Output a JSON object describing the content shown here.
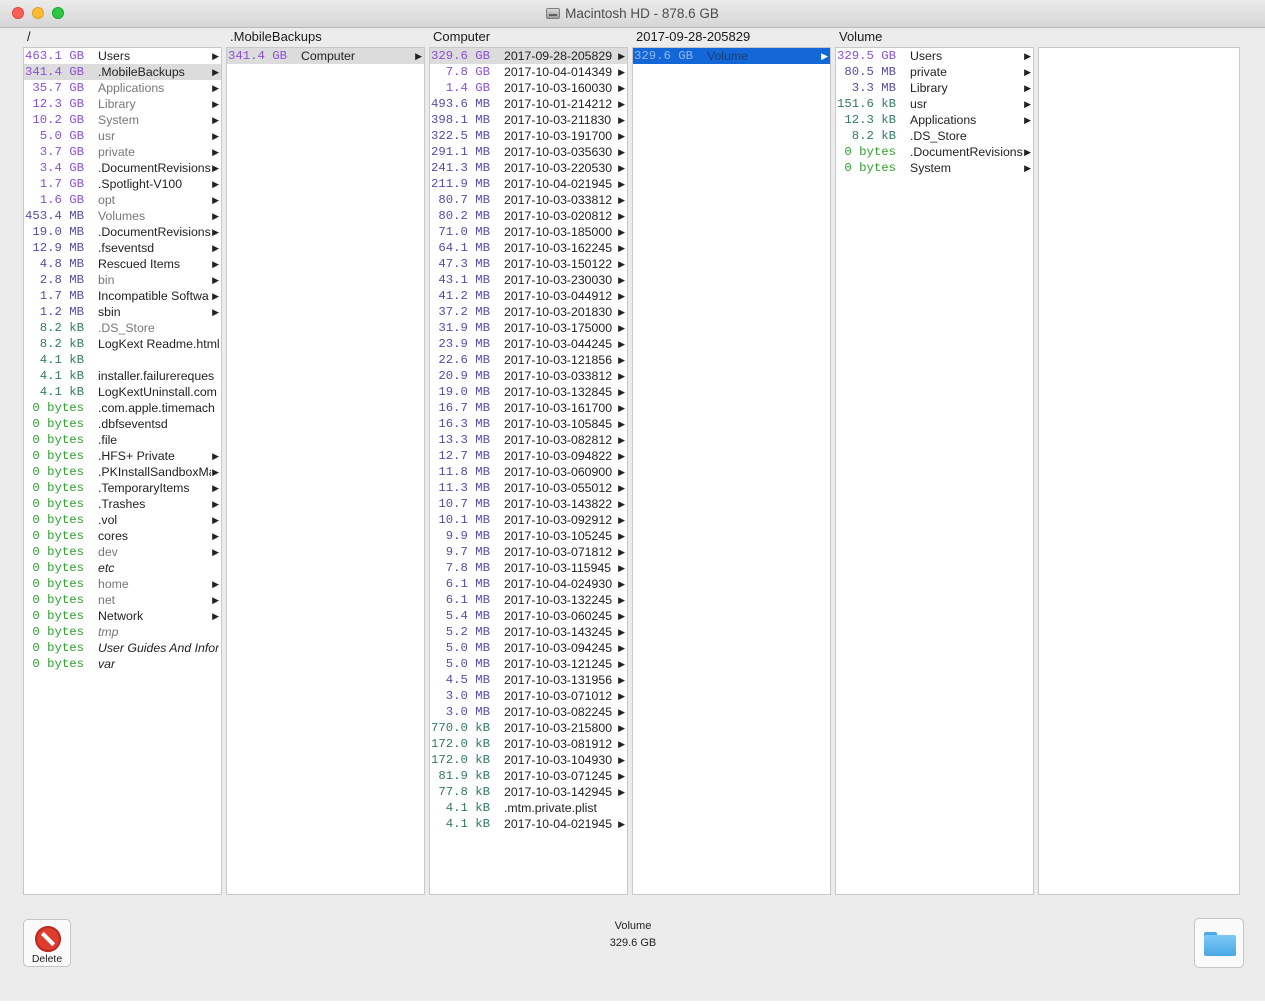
{
  "window": {
    "title": "Macintosh HD - 878.6 GB"
  },
  "columns": [
    {
      "header": "/",
      "rows": [
        {
          "size": "463.1 GB",
          "unit": "gb",
          "name": "Users",
          "arrow": true
        },
        {
          "size": "341.4 GB",
          "unit": "gb",
          "name": ".MobileBackups",
          "arrow": true,
          "selected": "gray"
        },
        {
          "size": "35.7 GB",
          "unit": "gb",
          "name": "Applications",
          "arrow": true,
          "style": "gray"
        },
        {
          "size": "12.3 GB",
          "unit": "gb",
          "name": "Library",
          "arrow": true,
          "style": "gray"
        },
        {
          "size": "10.2 GB",
          "unit": "gb",
          "name": "System",
          "arrow": true,
          "style": "gray"
        },
        {
          "size": "5.0 GB",
          "unit": "gb",
          "name": "usr",
          "arrow": true,
          "style": "gray"
        },
        {
          "size": "3.7 GB",
          "unit": "gb",
          "name": "private",
          "arrow": true,
          "style": "gray"
        },
        {
          "size": "3.4 GB",
          "unit": "gb",
          "name": ".DocumentRevisions",
          "arrow": true
        },
        {
          "size": "1.7 GB",
          "unit": "gb",
          "name": ".Spotlight-V100",
          "arrow": true
        },
        {
          "size": "1.6 GB",
          "unit": "gb",
          "name": "opt",
          "arrow": true,
          "style": "gray"
        },
        {
          "size": "453.4 MB",
          "unit": "mb",
          "name": "Volumes",
          "arrow": true,
          "style": "gray"
        },
        {
          "size": "19.0 MB",
          "unit": "mb",
          "name": ".DocumentRevisions",
          "arrow": true
        },
        {
          "size": "12.9 MB",
          "unit": "mb",
          "name": ".fseventsd",
          "arrow": true
        },
        {
          "size": "4.8 MB",
          "unit": "mb",
          "name": "Rescued Items",
          "arrow": true
        },
        {
          "size": "2.8 MB",
          "unit": "mb",
          "name": "bin",
          "arrow": true,
          "style": "gray"
        },
        {
          "size": "1.7 MB",
          "unit": "mb",
          "name": "Incompatible Softwa",
          "arrow": true
        },
        {
          "size": "1.2 MB",
          "unit": "mb",
          "name": "sbin",
          "arrow": true
        },
        {
          "size": "8.2 kB",
          "unit": "kb",
          "name": ".DS_Store",
          "arrow": false,
          "style": "gray"
        },
        {
          "size": "8.2 kB",
          "unit": "kb",
          "name": "LogKext Readme.html",
          "arrow": false
        },
        {
          "size": "4.1 kB",
          "unit": "kb",
          "name": "",
          "arrow": false
        },
        {
          "size": "4.1 kB",
          "unit": "kb",
          "name": "installer.failurereques",
          "arrow": false
        },
        {
          "size": "4.1 kB",
          "unit": "kb",
          "name": "LogKextUninstall.com",
          "arrow": false
        },
        {
          "size": "0 bytes",
          "unit": "by",
          "name": ".com.apple.timemach",
          "arrow": false
        },
        {
          "size": "0 bytes",
          "unit": "by",
          "name": ".dbfseventsd",
          "arrow": false
        },
        {
          "size": "0 bytes",
          "unit": "by",
          "name": ".file",
          "arrow": false
        },
        {
          "size": "0 bytes",
          "unit": "by",
          "name": ".HFS+ Private",
          "arrow": true
        },
        {
          "size": "0 bytes",
          "unit": "by",
          "name": ".PKInstallSandboxMa",
          "arrow": true
        },
        {
          "size": "0 bytes",
          "unit": "by",
          "name": ".TemporaryItems",
          "arrow": true
        },
        {
          "size": "0 bytes",
          "unit": "by",
          "name": ".Trashes",
          "arrow": true
        },
        {
          "size": "0 bytes",
          "unit": "by",
          "name": ".vol",
          "arrow": true
        },
        {
          "size": "0 bytes",
          "unit": "by",
          "name": "cores",
          "arrow": true
        },
        {
          "size": "0 bytes",
          "unit": "by",
          "name": "dev",
          "arrow": true,
          "style": "gray"
        },
        {
          "size": "0 bytes",
          "unit": "by",
          "name": "etc",
          "arrow": false,
          "style": "italic"
        },
        {
          "size": "0 bytes",
          "unit": "by",
          "name": "home",
          "arrow": true,
          "style": "gray"
        },
        {
          "size": "0 bytes",
          "unit": "by",
          "name": "net",
          "arrow": true,
          "style": "gray"
        },
        {
          "size": "0 bytes",
          "unit": "by",
          "name": "Network",
          "arrow": true
        },
        {
          "size": "0 bytes",
          "unit": "by",
          "name": "tmp",
          "arrow": false,
          "style": "gray-italic"
        },
        {
          "size": "0 bytes",
          "unit": "by",
          "name": "User Guides And Inforr",
          "arrow": false,
          "style": "italic"
        },
        {
          "size": "0 bytes",
          "unit": "by",
          "name": "var",
          "arrow": false,
          "style": "italic"
        }
      ]
    },
    {
      "header": ".MobileBackups",
      "rows": [
        {
          "size": "341.4 GB",
          "unit": "gb",
          "name": "Computer",
          "arrow": true,
          "selected": "gray"
        }
      ]
    },
    {
      "header": "Computer",
      "rows": [
        {
          "size": "329.6 GB",
          "unit": "gb",
          "name": "2017-09-28-205829",
          "arrow": true,
          "selected": "gray"
        },
        {
          "size": "7.8 GB",
          "unit": "gb",
          "name": "2017-10-04-014349",
          "arrow": true
        },
        {
          "size": "1.4 GB",
          "unit": "gb",
          "name": "2017-10-03-160030",
          "arrow": true
        },
        {
          "size": "493.6 MB",
          "unit": "mb",
          "name": "2017-10-01-214212",
          "arrow": true
        },
        {
          "size": "398.1 MB",
          "unit": "mb",
          "name": "2017-10-03-211830",
          "arrow": true
        },
        {
          "size": "322.5 MB",
          "unit": "mb",
          "name": "2017-10-03-191700",
          "arrow": true
        },
        {
          "size": "291.1 MB",
          "unit": "mb",
          "name": "2017-10-03-035630",
          "arrow": true
        },
        {
          "size": "241.3 MB",
          "unit": "mb",
          "name": "2017-10-03-220530",
          "arrow": true
        },
        {
          "size": "211.9 MB",
          "unit": "mb",
          "name": "2017-10-04-021945",
          "arrow": true
        },
        {
          "size": "80.7 MB",
          "unit": "mb",
          "name": "2017-10-03-033812",
          "arrow": true
        },
        {
          "size": "80.2 MB",
          "unit": "mb",
          "name": "2017-10-03-020812",
          "arrow": true
        },
        {
          "size": "71.0 MB",
          "unit": "mb",
          "name": "2017-10-03-185000",
          "arrow": true
        },
        {
          "size": "64.1 MB",
          "unit": "mb",
          "name": "2017-10-03-162245",
          "arrow": true
        },
        {
          "size": "47.3 MB",
          "unit": "mb",
          "name": "2017-10-03-150122",
          "arrow": true
        },
        {
          "size": "43.1 MB",
          "unit": "mb",
          "name": "2017-10-03-230030",
          "arrow": true
        },
        {
          "size": "41.2 MB",
          "unit": "mb",
          "name": "2017-10-03-044912",
          "arrow": true
        },
        {
          "size": "37.2 MB",
          "unit": "mb",
          "name": "2017-10-03-201830",
          "arrow": true
        },
        {
          "size": "31.9 MB",
          "unit": "mb",
          "name": "2017-10-03-175000",
          "arrow": true
        },
        {
          "size": "23.9 MB",
          "unit": "mb",
          "name": "2017-10-03-044245",
          "arrow": true
        },
        {
          "size": "22.6 MB",
          "unit": "mb",
          "name": "2017-10-03-121856",
          "arrow": true
        },
        {
          "size": "20.9 MB",
          "unit": "mb",
          "name": "2017-10-03-033812",
          "arrow": true
        },
        {
          "size": "19.0 MB",
          "unit": "mb",
          "name": "2017-10-03-132845",
          "arrow": true
        },
        {
          "size": "16.7 MB",
          "unit": "mb",
          "name": "2017-10-03-161700",
          "arrow": true
        },
        {
          "size": "16.3 MB",
          "unit": "mb",
          "name": "2017-10-03-105845",
          "arrow": true
        },
        {
          "size": "13.3 MB",
          "unit": "mb",
          "name": "2017-10-03-082812",
          "arrow": true
        },
        {
          "size": "12.7 MB",
          "unit": "mb",
          "name": "2017-10-03-094822",
          "arrow": true
        },
        {
          "size": "11.8 MB",
          "unit": "mb",
          "name": "2017-10-03-060900",
          "arrow": true
        },
        {
          "size": "11.3 MB",
          "unit": "mb",
          "name": "2017-10-03-055012",
          "arrow": true
        },
        {
          "size": "10.7 MB",
          "unit": "mb",
          "name": "2017-10-03-143822",
          "arrow": true
        },
        {
          "size": "10.1 MB",
          "unit": "mb",
          "name": "2017-10-03-092912",
          "arrow": true
        },
        {
          "size": "9.9 MB",
          "unit": "mb",
          "name": "2017-10-03-105245",
          "arrow": true
        },
        {
          "size": "9.7 MB",
          "unit": "mb",
          "name": "2017-10-03-071812",
          "arrow": true
        },
        {
          "size": "7.8 MB",
          "unit": "mb",
          "name": "2017-10-03-115945",
          "arrow": true
        },
        {
          "size": "6.1 MB",
          "unit": "mb",
          "name": "2017-10-04-024930",
          "arrow": true
        },
        {
          "size": "6.1 MB",
          "unit": "mb",
          "name": "2017-10-03-132245",
          "arrow": true
        },
        {
          "size": "5.4 MB",
          "unit": "mb",
          "name": "2017-10-03-060245",
          "arrow": true
        },
        {
          "size": "5.2 MB",
          "unit": "mb",
          "name": "2017-10-03-143245",
          "arrow": true
        },
        {
          "size": "5.0 MB",
          "unit": "mb",
          "name": "2017-10-03-094245",
          "arrow": true
        },
        {
          "size": "5.0 MB",
          "unit": "mb",
          "name": "2017-10-03-121245",
          "arrow": true
        },
        {
          "size": "4.5 MB",
          "unit": "mb",
          "name": "2017-10-03-131956",
          "arrow": true
        },
        {
          "size": "3.0 MB",
          "unit": "mb",
          "name": "2017-10-03-071012",
          "arrow": true
        },
        {
          "size": "3.0 MB",
          "unit": "mb",
          "name": "2017-10-03-082245",
          "arrow": true
        },
        {
          "size": "770.0 kB",
          "unit": "kb",
          "name": "2017-10-03-215800",
          "arrow": true
        },
        {
          "size": "172.0 kB",
          "unit": "kb",
          "name": "2017-10-03-081912",
          "arrow": true
        },
        {
          "size": "172.0 kB",
          "unit": "kb",
          "name": "2017-10-03-104930",
          "arrow": true
        },
        {
          "size": "81.9 kB",
          "unit": "kb",
          "name": "2017-10-03-071245",
          "arrow": true
        },
        {
          "size": "77.8 kB",
          "unit": "kb",
          "name": "2017-10-03-142945",
          "arrow": true
        },
        {
          "size": "4.1 kB",
          "unit": "kb",
          "name": ".mtm.private.plist",
          "arrow": false
        },
        {
          "size": "4.1 kB",
          "unit": "kb",
          "name": "2017-10-04-021945",
          "arrow": true
        }
      ]
    },
    {
      "header": "2017-09-28-205829",
      "rows": [
        {
          "size": "329.6 GB",
          "unit": "gb",
          "name": "Volume",
          "arrow": true,
          "selected": "blue"
        }
      ]
    },
    {
      "header": "Volume",
      "rows": [
        {
          "size": "329.5 GB",
          "unit": "gb",
          "name": "Users",
          "arrow": true
        },
        {
          "size": "80.5 MB",
          "unit": "mb",
          "name": "private",
          "arrow": true
        },
        {
          "size": "3.3 MB",
          "unit": "mb",
          "name": "Library",
          "arrow": true
        },
        {
          "size": "151.6 kB",
          "unit": "kb",
          "name": "usr",
          "arrow": true
        },
        {
          "size": "12.3 kB",
          "unit": "kb",
          "name": "Applications",
          "arrow": true
        },
        {
          "size": "8.2 kB",
          "unit": "kb",
          "name": ".DS_Store",
          "arrow": false
        },
        {
          "size": "0 bytes",
          "unit": "by",
          "name": ".DocumentRevisions",
          "arrow": true
        },
        {
          "size": "0 bytes",
          "unit": "by",
          "name": "System",
          "arrow": true
        }
      ]
    },
    {
      "header": "",
      "rows": []
    }
  ],
  "footer": {
    "selected_name": "Volume",
    "selected_size": "329.6 GB",
    "delete_label": "Delete"
  },
  "icons": {
    "delete": "no-entry-icon",
    "reveal": "folder-icon",
    "arrow": "▶"
  },
  "colors": {
    "selection_blue": "#1467d7",
    "size_gb": "#8a4fd8",
    "size_mb": "#5a4aa8",
    "size_kb": "#337a68",
    "size_bytes": "#2fa02f"
  }
}
